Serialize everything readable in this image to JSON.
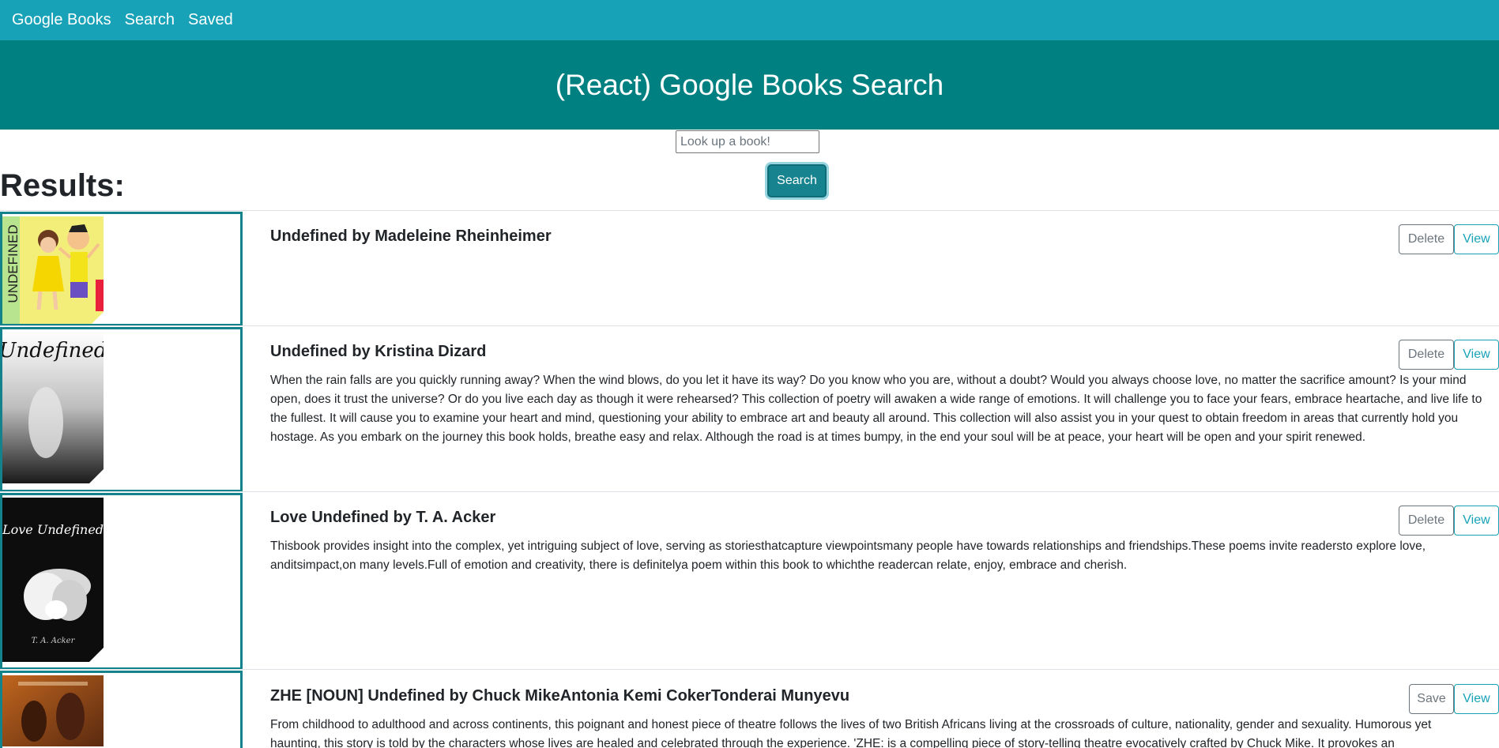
{
  "nav": {
    "brand": "Google Books",
    "links": [
      "Search",
      "Saved"
    ]
  },
  "header": {
    "title": "(React) Google Books Search"
  },
  "search": {
    "placeholder": "Look up a book!",
    "value": "",
    "button_label": "Search"
  },
  "results": {
    "heading": "Results:",
    "books": [
      {
        "title": "Undefined by Madeleine Rheinheimer",
        "description": "",
        "action_label": "Delete",
        "view_label": "View",
        "cover_text": "UNDEFINED"
      },
      {
        "title": "Undefined by Kristina Dizard",
        "description": "When the rain falls are you quickly running away? When the wind blows, do you let it have its way? Do you know who you are, without a doubt? Would you always choose love, no matter the sacrifice amount? Is your mind open, does it trust the universe? Or do you live each day as though it were rehearsed? This collection of poetry will awaken a wide range of emotions. It will challenge you to face your fears, embrace heartache, and live life to the fullest. It will cause you to examine your heart and mind, questioning your ability to embrace art and beauty all around. This collection will also assist you in your quest to obtain freedom in areas that currently hold you hostage. As you embark on the journey this book holds, breathe easy and relax. Although the road is at times bumpy, in the end your soul will be at peace, your heart will be open and your spirit renewed.",
        "action_label": "Delete",
        "view_label": "View",
        "cover_text": "Undefined"
      },
      {
        "title": "Love Undefined by T. A. Acker",
        "description": "Thisbook provides insight into the complex, yet intriguing subject of love, serving as storiesthatcapture viewpointsmany people have towards relationships and friendships.These poems invite readersto explore love, anditsimpact,on many levels.Full of emotion and creativity, there is definitelya poem within this book to whichthe readercan relate, enjoy, embrace and cherish.",
        "action_label": "Delete",
        "view_label": "View",
        "cover_text": "Love Undefined",
        "cover_author": "T. A. Acker"
      },
      {
        "title": "ZHE [NOUN] Undefined by Chuck MikeAntonia Kemi CokerTonderai Munyevu",
        "description": "From childhood to adulthood and across continents, this poignant and honest piece of theatre follows the lives of two British Africans living at the crossroads of culture, nationality, gender and sexuality. Humorous yet haunting, this story is told by the characters whose lives are healed and celebrated through the experience. 'ZHE: is a compelling piece of story-telling theatre evocatively crafted by Chuck Mike. It provokes an",
        "action_label": "Save",
        "view_label": "View"
      }
    ]
  },
  "colors": {
    "navbar": "#17a2b8",
    "header": "#008080",
    "accent": "#17a2b8",
    "card_border": "#12838a"
  }
}
